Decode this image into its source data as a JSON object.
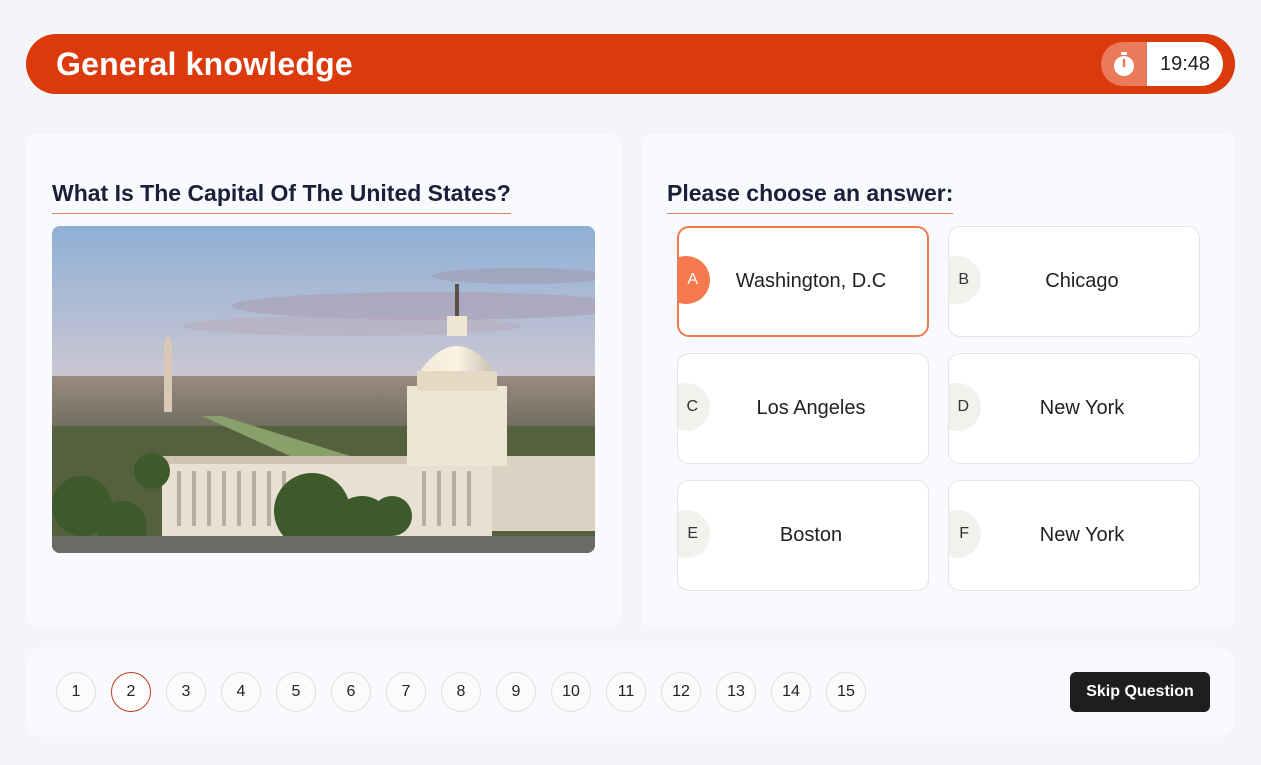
{
  "header": {
    "title": "General knowledge",
    "timer": "19:48",
    "timer_icon": "stopwatch-icon"
  },
  "question": {
    "text": "What Is The Capital Of The United States?",
    "image_icon": "us-capitol-photo"
  },
  "answers_panel": {
    "heading": "Please choose an answer:",
    "selected": "A",
    "options": [
      {
        "letter": "A",
        "text": "Washington, D.C"
      },
      {
        "letter": "B",
        "text": "Chicago"
      },
      {
        "letter": "C",
        "text": "Los Angeles"
      },
      {
        "letter": "D",
        "text": "New York"
      },
      {
        "letter": "E",
        "text": "Boston"
      },
      {
        "letter": "F",
        "text": "New York"
      }
    ]
  },
  "pagination": {
    "current": "2",
    "pages": [
      "1",
      "2",
      "3",
      "4",
      "5",
      "6",
      "7",
      "8",
      "9",
      "10",
      "11",
      "12",
      "13",
      "14",
      "15"
    ]
  },
  "skip_label": "Skip Question",
  "colors": {
    "accent": "#dc3a0c",
    "selected": "#f47a4e",
    "dark_button": "#1e1e20"
  }
}
